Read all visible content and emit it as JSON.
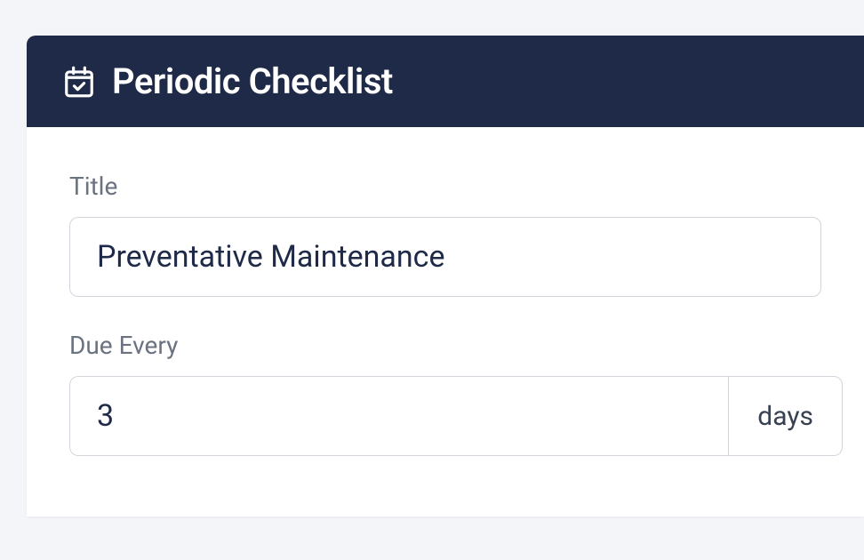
{
  "header": {
    "title": "Periodic Checklist"
  },
  "form": {
    "title": {
      "label": "Title",
      "value": "Preventative Maintenance"
    },
    "dueEvery": {
      "label": "Due Every",
      "value": "3",
      "unit": "days"
    }
  }
}
